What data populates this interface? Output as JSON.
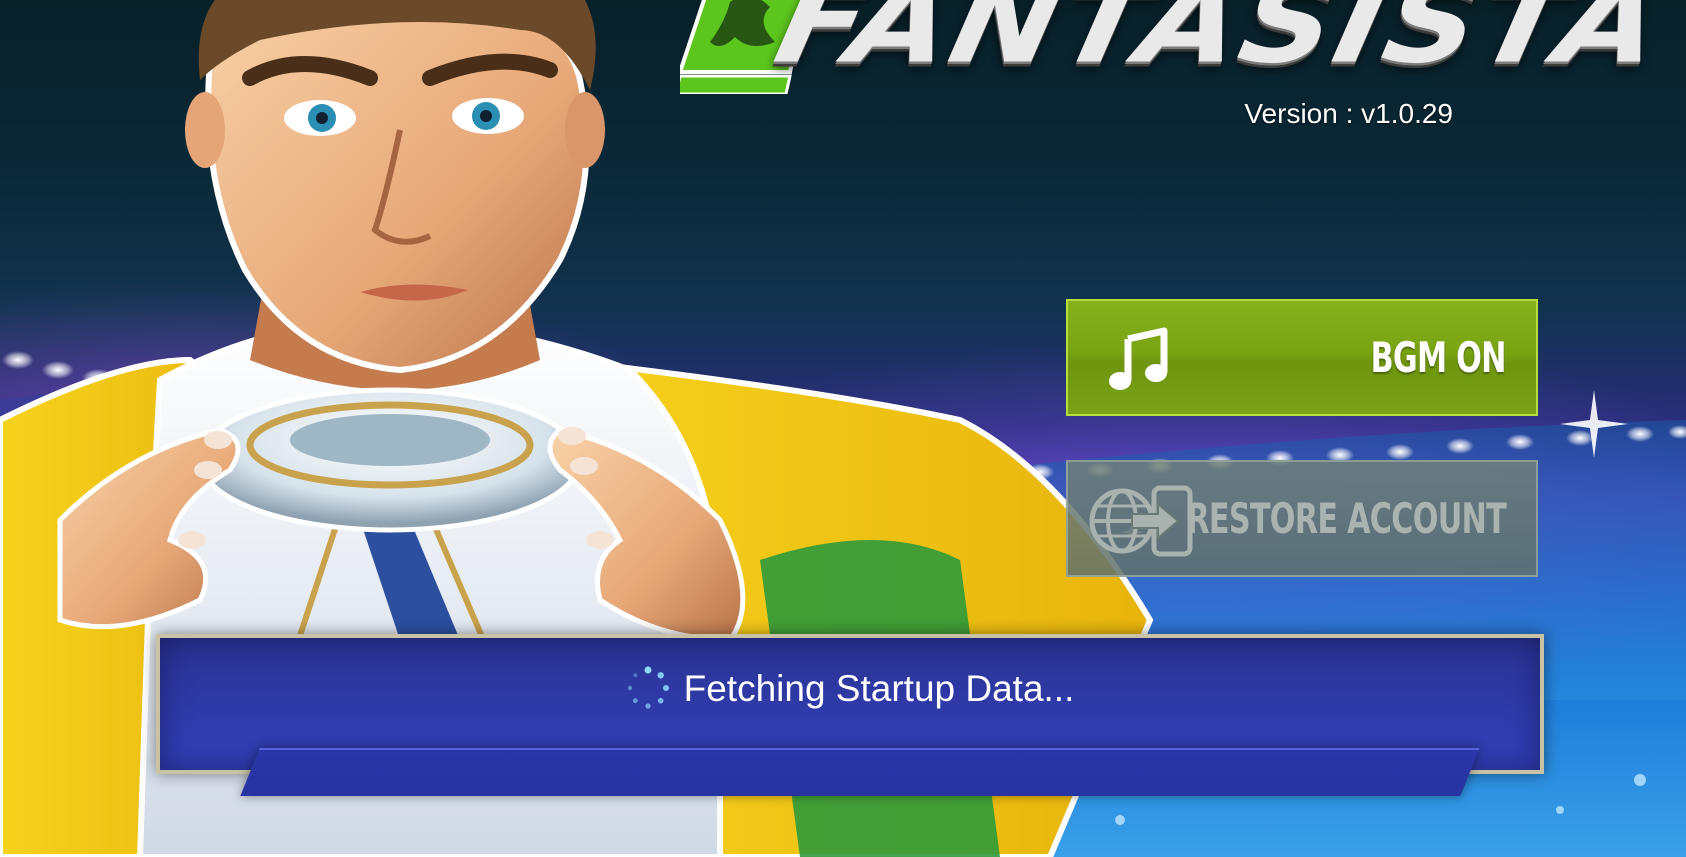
{
  "game": {
    "logo_text": "FANTASISTA",
    "version": "Version : v1.0.29"
  },
  "buttons": {
    "bgm": {
      "label": "BGM ON",
      "icon": "music-note-icon"
    },
    "restore": {
      "label": "RESTORE ACCOUNT",
      "icon": "globe-transfer-icon"
    }
  },
  "status": {
    "message": "Fetching Startup Data...",
    "icon": "loading-spinner-icon"
  },
  "colors": {
    "bgm_button": "#7aa313",
    "restore_button": "#6a7a74",
    "status_bar": "#2f3aa8",
    "logo_green": "#5cc61e"
  }
}
